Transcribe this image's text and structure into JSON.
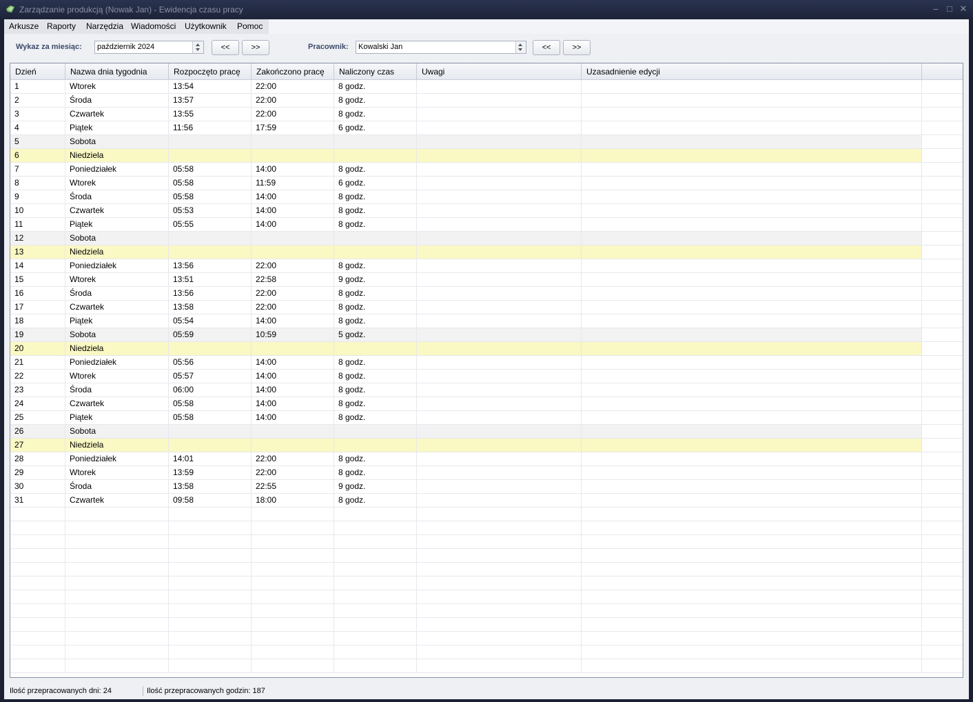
{
  "window": {
    "title": "Zarządzanie produkcją (Nowak Jan) - Ewidencja czasu pracy"
  },
  "menu": [
    "Arkusze",
    "Raporty",
    "Narzędzia",
    "Wiadomości",
    "Użytkownik",
    "Pomoc"
  ],
  "toolbar": {
    "month_label": "Wykaz za miesiąc:",
    "month_value": "październik 2024",
    "prev_label": "<<",
    "next_label": ">>",
    "employee_label": "Pracownik:",
    "employee_value": "Kowalski Jan",
    "emp_prev_label": "<<",
    "emp_next_label": ">>"
  },
  "table": {
    "columns": [
      "Dzień",
      "Nazwa dnia tygodnia",
      "Rozpoczęto pracę",
      "Zakończono pracę",
      "Naliczony czas",
      "Uwagi",
      "Uzasadnienie edycji"
    ],
    "rows": [
      {
        "day": "1",
        "name": "Wtorek",
        "start": "13:54",
        "end": "22:00",
        "time": "8 godz.",
        "notes": "",
        "reason": "",
        "kind": "work"
      },
      {
        "day": "2",
        "name": "Środa",
        "start": "13:57",
        "end": "22:00",
        "time": "8 godz.",
        "notes": "",
        "reason": "",
        "kind": "work"
      },
      {
        "day": "3",
        "name": "Czwartek",
        "start": "13:55",
        "end": "22:00",
        "time": "8 godz.",
        "notes": "",
        "reason": "",
        "kind": "work"
      },
      {
        "day": "4",
        "name": "Piątek",
        "start": "11:56",
        "end": "17:59",
        "time": "6 godz.",
        "notes": "",
        "reason": "",
        "kind": "work"
      },
      {
        "day": "5",
        "name": "Sobota",
        "start": "",
        "end": "",
        "time": "",
        "notes": "",
        "reason": "",
        "kind": "sat"
      },
      {
        "day": "6",
        "name": "Niedziela",
        "start": "",
        "end": "",
        "time": "",
        "notes": "",
        "reason": "",
        "kind": "sun"
      },
      {
        "day": "7",
        "name": "Poniedziałek",
        "start": "05:58",
        "end": "14:00",
        "time": "8 godz.",
        "notes": "",
        "reason": "",
        "kind": "work"
      },
      {
        "day": "8",
        "name": "Wtorek",
        "start": "05:58",
        "end": "11:59",
        "time": "6 godz.",
        "notes": "",
        "reason": "",
        "kind": "work"
      },
      {
        "day": "9",
        "name": "Środa",
        "start": "05:58",
        "end": "14:00",
        "time": "8 godz.",
        "notes": "",
        "reason": "",
        "kind": "work"
      },
      {
        "day": "10",
        "name": "Czwartek",
        "start": "05:53",
        "end": "14:00",
        "time": "8 godz.",
        "notes": "",
        "reason": "",
        "kind": "work"
      },
      {
        "day": "11",
        "name": "Piątek",
        "start": "05:55",
        "end": "14:00",
        "time": "8 godz.",
        "notes": "",
        "reason": "",
        "kind": "work"
      },
      {
        "day": "12",
        "name": "Sobota",
        "start": "",
        "end": "",
        "time": "",
        "notes": "",
        "reason": "",
        "kind": "sat"
      },
      {
        "day": "13",
        "name": "Niedziela",
        "start": "",
        "end": "",
        "time": "",
        "notes": "",
        "reason": "",
        "kind": "sun"
      },
      {
        "day": "14",
        "name": "Poniedziałek",
        "start": "13:56",
        "end": "22:00",
        "time": "8 godz.",
        "notes": "",
        "reason": "",
        "kind": "work"
      },
      {
        "day": "15",
        "name": "Wtorek",
        "start": "13:51",
        "end": "22:58",
        "time": "9 godz.",
        "notes": "",
        "reason": "",
        "kind": "work"
      },
      {
        "day": "16",
        "name": "Środa",
        "start": "13:56",
        "end": "22:00",
        "time": "8 godz.",
        "notes": "",
        "reason": "",
        "kind": "work"
      },
      {
        "day": "17",
        "name": "Czwartek",
        "start": "13:58",
        "end": "22:00",
        "time": "8 godz.",
        "notes": "",
        "reason": "",
        "kind": "work"
      },
      {
        "day": "18",
        "name": "Piątek",
        "start": "05:54",
        "end": "14:00",
        "time": "8 godz.",
        "notes": "",
        "reason": "",
        "kind": "work"
      },
      {
        "day": "19",
        "name": "Sobota",
        "start": "05:59",
        "end": "10:59",
        "time": "5 godz.",
        "notes": "",
        "reason": "",
        "kind": "sat"
      },
      {
        "day": "20",
        "name": "Niedziela",
        "start": "",
        "end": "",
        "time": "",
        "notes": "",
        "reason": "",
        "kind": "sun"
      },
      {
        "day": "21",
        "name": "Poniedziałek",
        "start": "05:56",
        "end": "14:00",
        "time": "8 godz.",
        "notes": "",
        "reason": "",
        "kind": "work"
      },
      {
        "day": "22",
        "name": "Wtorek",
        "start": "05:57",
        "end": "14:00",
        "time": "8 godz.",
        "notes": "",
        "reason": "",
        "kind": "work"
      },
      {
        "day": "23",
        "name": "Środa",
        "start": "06:00",
        "end": "14:00",
        "time": "8 godz.",
        "notes": "",
        "reason": "",
        "kind": "work"
      },
      {
        "day": "24",
        "name": "Czwartek",
        "start": "05:58",
        "end": "14:00",
        "time": "8 godz.",
        "notes": "",
        "reason": "",
        "kind": "work"
      },
      {
        "day": "25",
        "name": "Piątek",
        "start": "05:58",
        "end": "14:00",
        "time": "8 godz.",
        "notes": "",
        "reason": "",
        "kind": "work"
      },
      {
        "day": "26",
        "name": "Sobota",
        "start": "",
        "end": "",
        "time": "",
        "notes": "",
        "reason": "",
        "kind": "sat"
      },
      {
        "day": "27",
        "name": "Niedziela",
        "start": "",
        "end": "",
        "time": "",
        "notes": "",
        "reason": "",
        "kind": "sun"
      },
      {
        "day": "28",
        "name": "Poniedziałek",
        "start": "14:01",
        "end": "22:00",
        "time": "8 godz.",
        "notes": "",
        "reason": "",
        "kind": "work"
      },
      {
        "day": "29",
        "name": "Wtorek",
        "start": "13:59",
        "end": "22:00",
        "time": "8 godz.",
        "notes": "",
        "reason": "",
        "kind": "work"
      },
      {
        "day": "30",
        "name": "Środa",
        "start": "13:58",
        "end": "22:55",
        "time": "9 godz.",
        "notes": "",
        "reason": "",
        "kind": "work"
      },
      {
        "day": "31",
        "name": "Czwartek",
        "start": "09:58",
        "end": "18:00",
        "time": "8 godz.",
        "notes": "",
        "reason": "",
        "kind": "work"
      }
    ]
  },
  "status": {
    "days": "Ilość przepracowanych dni: 24",
    "hours": "Ilość przepracowanych godzin: 187"
  },
  "colors": {
    "saturday_row": "#f2f2f3",
    "sunday_row": "#faf8c3",
    "title_bar": "#1d2438"
  }
}
